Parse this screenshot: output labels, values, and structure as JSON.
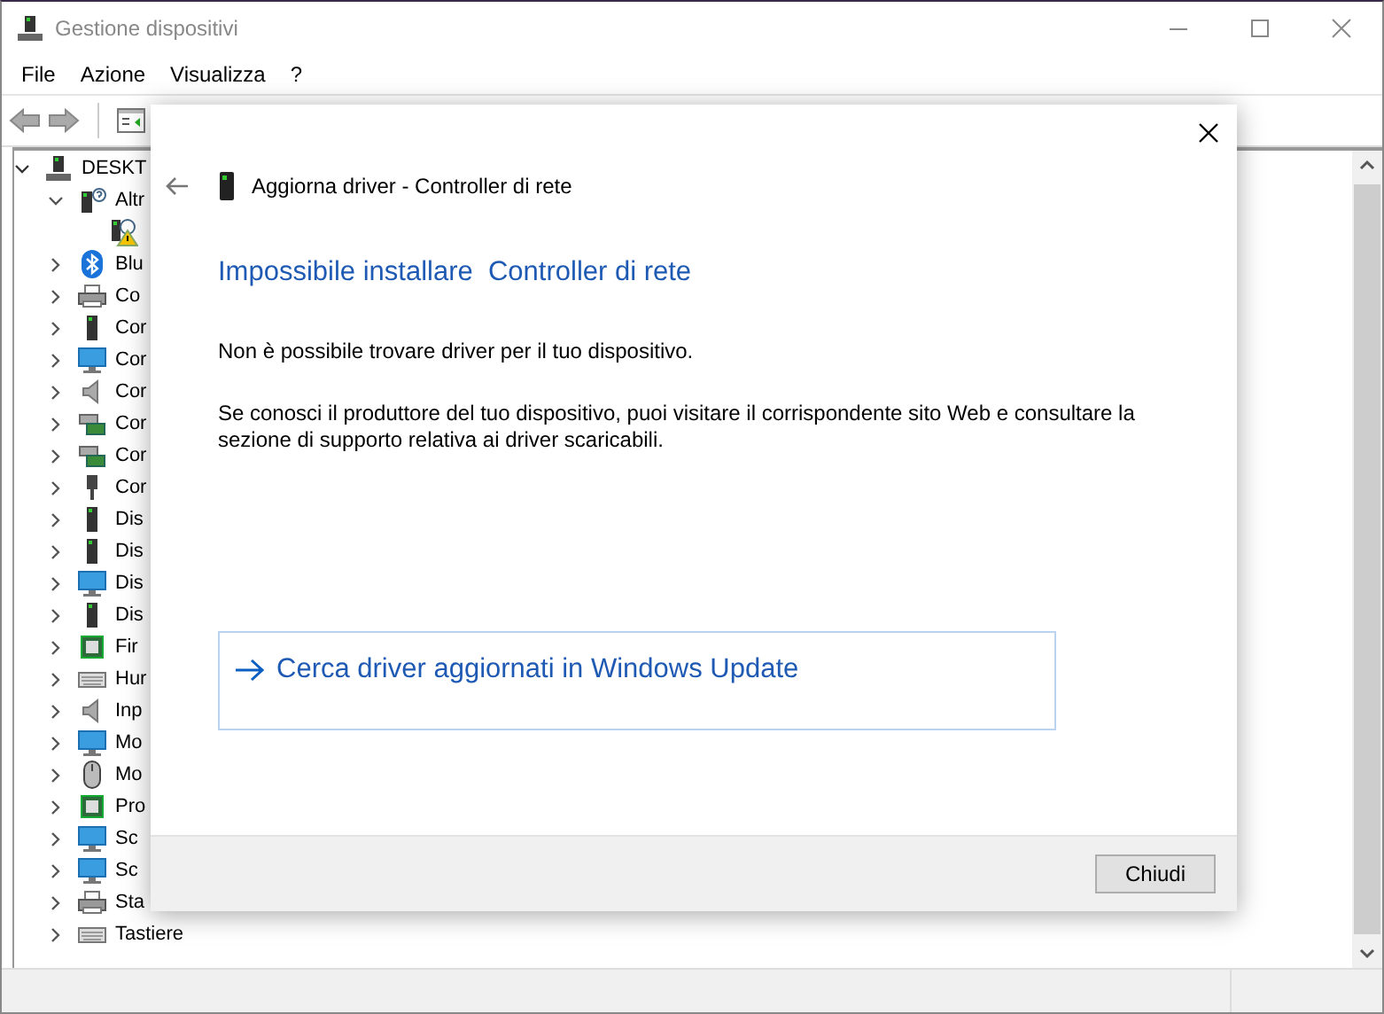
{
  "window": {
    "title": "Gestione dispositivi"
  },
  "menu": [
    "File",
    "Azione",
    "Visualizza",
    "?"
  ],
  "tree": [
    {
      "label": "DESKT",
      "expanded": true,
      "children": [
        {
          "label": "Altr",
          "expanded": true,
          "children": [
            {
              "warning": true
            }
          ]
        },
        {
          "label": "Blu",
          "expanded": false
        },
        {
          "label": "Co",
          "expanded": false
        },
        {
          "label": "Cor",
          "expanded": false
        },
        {
          "label": "Cor",
          "expanded": false
        },
        {
          "label": "Cor",
          "expanded": false
        },
        {
          "label": "Cor",
          "expanded": false
        },
        {
          "label": "Cor",
          "expanded": false
        },
        {
          "label": "Cor",
          "expanded": false
        },
        {
          "label": "Dis",
          "expanded": false
        },
        {
          "label": "Dis",
          "expanded": false
        },
        {
          "label": "Dis",
          "expanded": false
        },
        {
          "label": "Dis",
          "expanded": false
        },
        {
          "label": "Fir",
          "expanded": false
        },
        {
          "label": "Hur",
          "expanded": false
        },
        {
          "label": "Inp",
          "expanded": false
        },
        {
          "label": "Mo",
          "expanded": false
        },
        {
          "label": "Mo",
          "expanded": false
        },
        {
          "label": "Pro",
          "expanded": false
        },
        {
          "label": "Sc",
          "expanded": false
        },
        {
          "label": "Sc",
          "expanded": false
        },
        {
          "label": "Sta",
          "expanded": false
        },
        {
          "label": "Tastiere",
          "expanded": false
        }
      ]
    }
  ],
  "dialog": {
    "header": "Aggiorna driver - Controller di rete",
    "heading": "Impossibile installare  Controller di rete",
    "paragraphs": [
      "Non è possibile trovare driver per il tuo dispositivo.",
      "Se conosci il produttore del tuo dispositivo, puoi visitare il corrispondente sito Web e consultare la sezione di supporto relativa ai driver scaricabili."
    ],
    "link": "Cerca driver aggiornati in Windows Update",
    "button": "Chiudi"
  }
}
